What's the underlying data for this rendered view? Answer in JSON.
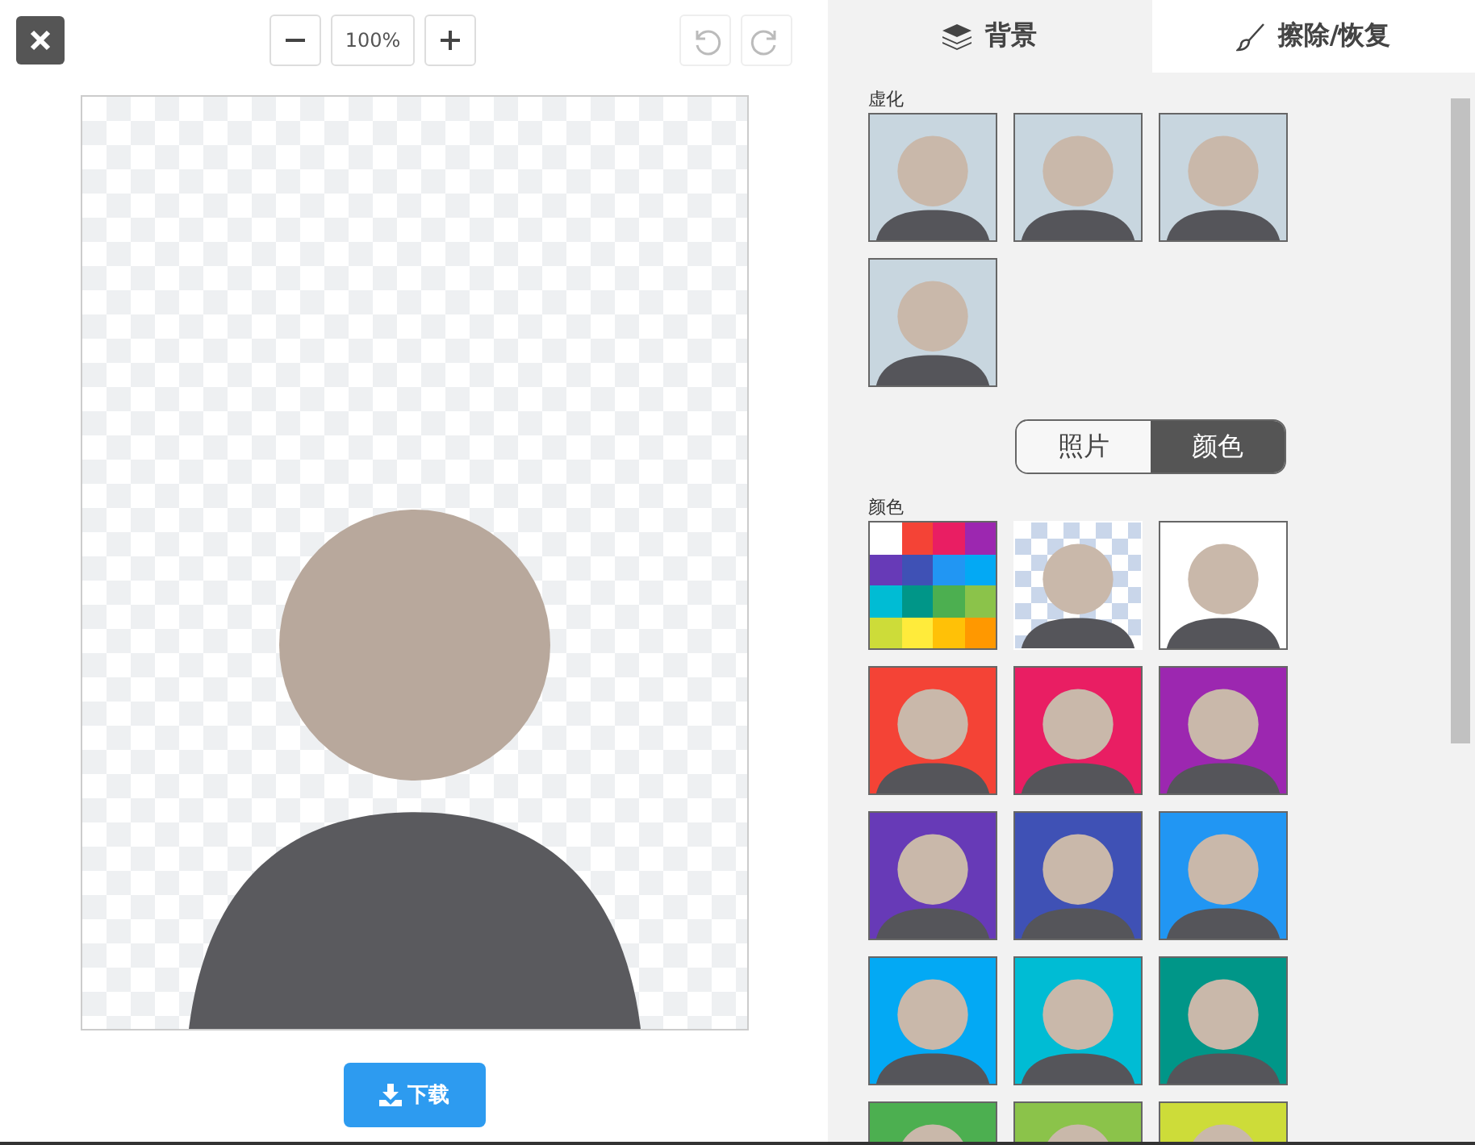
{
  "toolbar": {
    "zoom_value": "100%",
    "undo_disabled": true,
    "redo_disabled": true
  },
  "tabs": [
    {
      "label": "背景",
      "selected": true
    },
    {
      "label": "擦除/恢复",
      "selected": false
    }
  ],
  "blur": {
    "label": "虚化",
    "thumbnails": [
      {
        "kind": "photo"
      },
      {
        "kind": "photo"
      },
      {
        "kind": "photo"
      },
      {
        "kind": "photo"
      }
    ]
  },
  "mode_toggle": [
    {
      "label": "照片",
      "selected": false
    },
    {
      "label": "颜色",
      "selected": true
    }
  ],
  "colors": {
    "label": "颜色",
    "items": [
      {
        "kind": "palette"
      },
      {
        "kind": "transparent"
      },
      {
        "kind": "color",
        "color": "#ffffff"
      },
      {
        "kind": "color",
        "color": "#f44336"
      },
      {
        "kind": "color",
        "color": "#e91e63"
      },
      {
        "kind": "color",
        "color": "#9c27b0"
      },
      {
        "kind": "color",
        "color": "#673ab7"
      },
      {
        "kind": "color",
        "color": "#3f51b5"
      },
      {
        "kind": "color",
        "color": "#2196f3"
      },
      {
        "kind": "color",
        "color": "#03a9f4"
      },
      {
        "kind": "color",
        "color": "#00bcd4"
      },
      {
        "kind": "color",
        "color": "#009688"
      },
      {
        "kind": "color",
        "color": "#4caf50"
      },
      {
        "kind": "color",
        "color": "#8bc34a"
      },
      {
        "kind": "color",
        "color": "#cddc39"
      }
    ]
  },
  "download_button": {
    "label": "下载"
  }
}
